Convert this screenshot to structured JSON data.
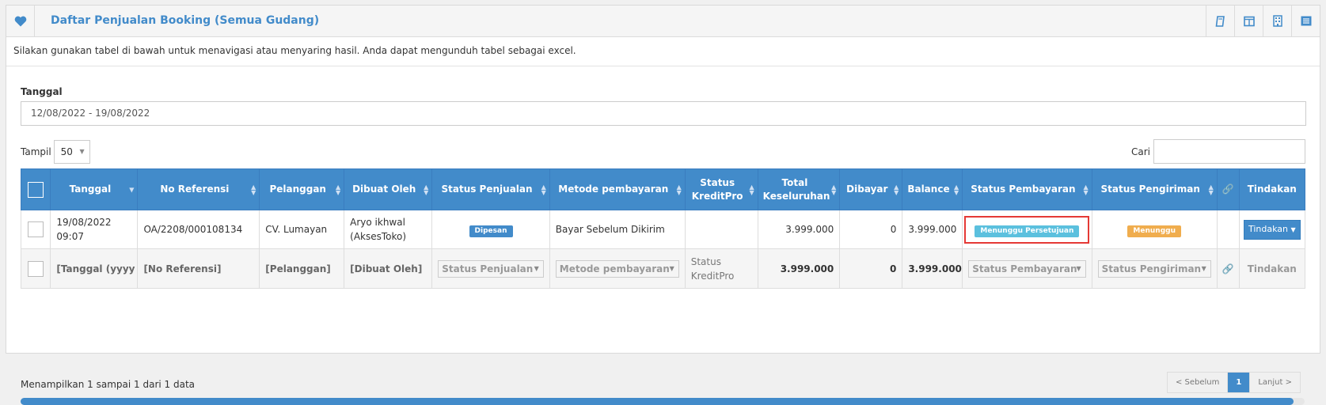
{
  "header": {
    "title": "Daftar Penjualan Booking (Semua Gudang)",
    "icon": "heart-icon",
    "tools": [
      "book-icon",
      "columns-icon",
      "building-icon",
      "list-icon"
    ]
  },
  "intro": "Silakan gunakan tabel di bawah untuk menavigasi atau menyaring hasil. Anda dapat mengunduh tabel sebagai excel.",
  "filter": {
    "date_label": "Tanggal",
    "date_value": "12/08/2022 - 19/08/2022",
    "show_label": "Tampil",
    "show_value": "50",
    "search_label": "Cari",
    "search_value": ""
  },
  "table": {
    "columns": [
      "Tanggal",
      "No Referensi",
      "Pelanggan",
      "Dibuat Oleh",
      "Status Penjualan",
      "Metode pembayaran",
      "Status KreditPro",
      "Total Keseluruhan",
      "Dibayar",
      "Balance",
      "Status Pembayaran",
      "Status Pengiriman",
      "Tindakan"
    ],
    "row": {
      "date": "19/08/2022",
      "time": "09:07",
      "ref": "OA/2208/000108134",
      "customer": "CV. Lumayan",
      "created_by_1": "Aryo ikhwal",
      "created_by_2": "(AksesToko)",
      "sale_status": "Dipesan",
      "payment_method": "Bayar Sebelum Dikirim",
      "kreditpro": "",
      "total": "3.999.000",
      "paid": "0",
      "balance": "3.999.000",
      "payment_status": "Menunggu Persetujuan",
      "delivery_status": "Menunggu",
      "action": "Tindakan"
    },
    "filter_row": {
      "date": "[Tanggal (yyyy",
      "ref": "[No Referensi]",
      "customer": "[Pelanggan]",
      "created_by": "[Dibuat Oleh]",
      "sale_status": "Status Penjualan",
      "payment_method": "Metode pembayaran",
      "kreditpro": "Status KreditPro",
      "total": "3.999.000",
      "paid": "0",
      "balance": "3.999.000",
      "payment_status": "Status Pembayaran",
      "delivery_status": "Status Pengiriman",
      "action": "Tindakan"
    }
  },
  "footer": {
    "info": "Menampilkan 1 sampai 1 dari 1 data",
    "prev": "< Sebelum",
    "page": "1",
    "next": "Lanjut >"
  },
  "colors": {
    "primary": "#428bca",
    "info": "#5bc0de",
    "warning": "#f0ad4e",
    "highlight": "#e53935"
  }
}
